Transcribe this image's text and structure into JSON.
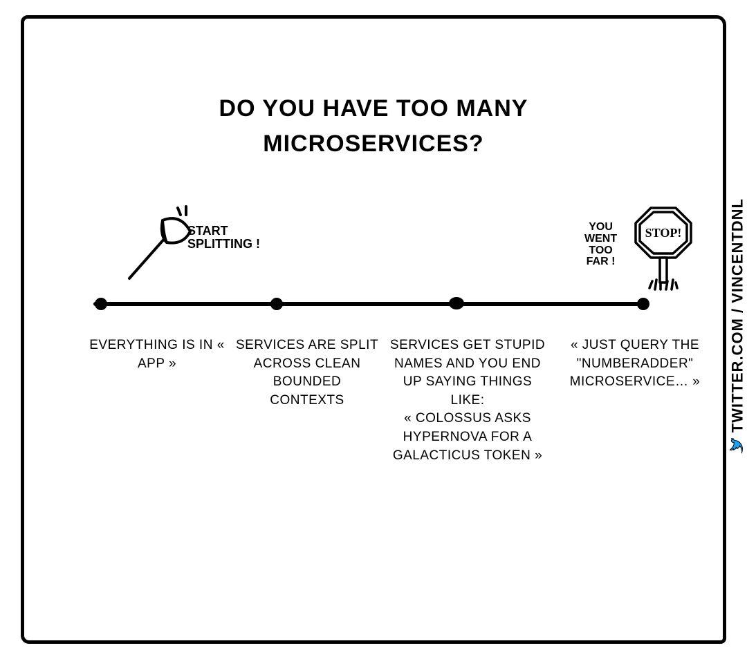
{
  "title_line1": "DO YOU HAVE TOO MANY",
  "title_line2": "MICROSERVICES?",
  "axe_caption_line1": "START",
  "axe_caption_line2": "SPLITTING !",
  "stop_sign_text": "STOP!",
  "stop_caption_line1": "YOU",
  "stop_caption_line2": "WENT",
  "stop_caption_line3": "TOO",
  "stop_caption_line4": "FAR !",
  "stages": {
    "0": "EVERYTHING IS IN « APP »",
    "1": "SERVICES ARE SPLIT ACROSS CLEAN BOUNDED CONTEXTS",
    "2": "SERVICES GET STUPID NAMES AND YOU END UP SAYING THINGS LIKE:\n« COLOSSUS ASKS HYPERNOVA FOR A GALACTICUS TOKEN »",
    "3": "« JUST QUERY THE \"NUMBERADDER\" MICROSERVICE… »"
  },
  "credit": "TWITTER.COM / VINCENTDNL"
}
